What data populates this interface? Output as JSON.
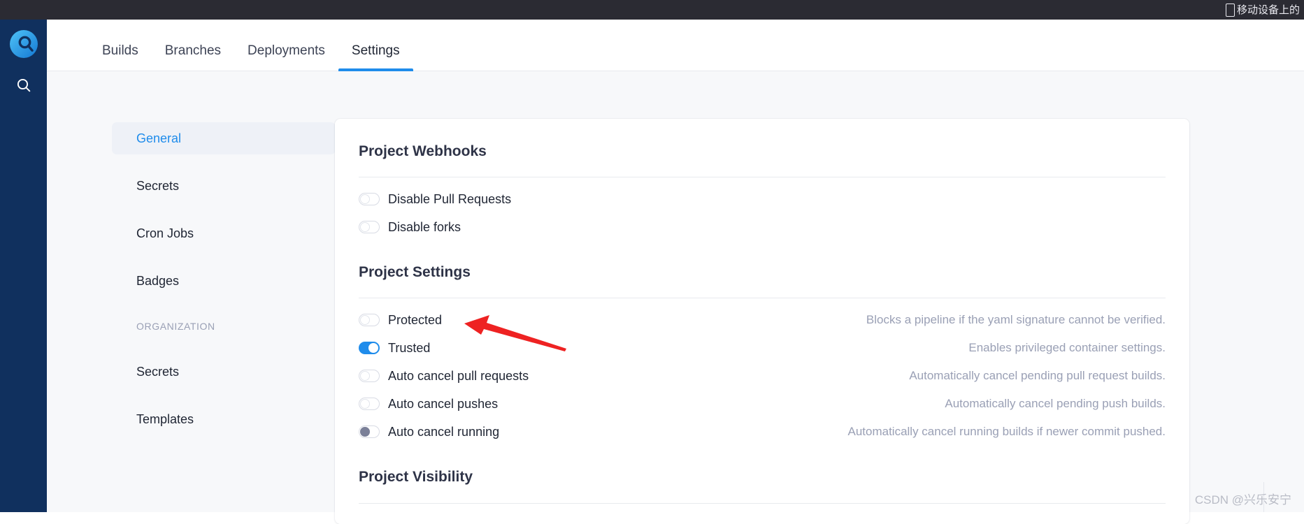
{
  "topbar": {
    "icon": "mobile-device-icon",
    "text": "移动设备上的"
  },
  "rail": {
    "logo_name": "drone-logo",
    "search_icon": "search-icon"
  },
  "nav": {
    "tabs": [
      {
        "label": "Builds",
        "active": false
      },
      {
        "label": "Branches",
        "active": false
      },
      {
        "label": "Deployments",
        "active": false
      },
      {
        "label": "Settings",
        "active": true
      }
    ]
  },
  "settings_menu": {
    "items": [
      {
        "label": "General",
        "active": true
      },
      {
        "label": "Secrets",
        "active": false
      },
      {
        "label": "Cron Jobs",
        "active": false
      },
      {
        "label": "Badges",
        "active": false
      }
    ],
    "org_heading": "ORGANIZATION",
    "org_items": [
      {
        "label": "Secrets",
        "active": false
      },
      {
        "label": "Templates",
        "active": false
      }
    ]
  },
  "webhooks": {
    "title": "Project Webhooks",
    "options": [
      {
        "label": "Disable Pull Requests",
        "state": "off",
        "description": ""
      },
      {
        "label": "Disable forks",
        "state": "off",
        "description": ""
      }
    ]
  },
  "project_settings": {
    "title": "Project Settings",
    "options": [
      {
        "label": "Protected",
        "state": "off",
        "description": "Blocks a pipeline if the yaml signature cannot be verified."
      },
      {
        "label": "Trusted",
        "state": "on",
        "description": "Enables privileged container settings."
      },
      {
        "label": "Auto cancel pull requests",
        "state": "off",
        "description": "Automatically cancel pending pull request builds."
      },
      {
        "label": "Auto cancel pushes",
        "state": "off",
        "description": "Automatically cancel pending push builds."
      },
      {
        "label": "Auto cancel running",
        "state": "muted",
        "description": "Automatically cancel running builds if newer commit pushed."
      }
    ]
  },
  "visibility": {
    "title": "Project Visibility"
  },
  "annotation": {
    "name": "red-arrow-pointing-to-trusted-toggle",
    "color": "#ee2222"
  },
  "watermark": {
    "text": "CSDN @兴乐安宁"
  },
  "colors": {
    "accent": "#1f8ceb",
    "rail": "#10305e",
    "topbar": "#2b2b33",
    "page_bg": "#f7f8fa",
    "muted_text": "#9aa0b5"
  }
}
